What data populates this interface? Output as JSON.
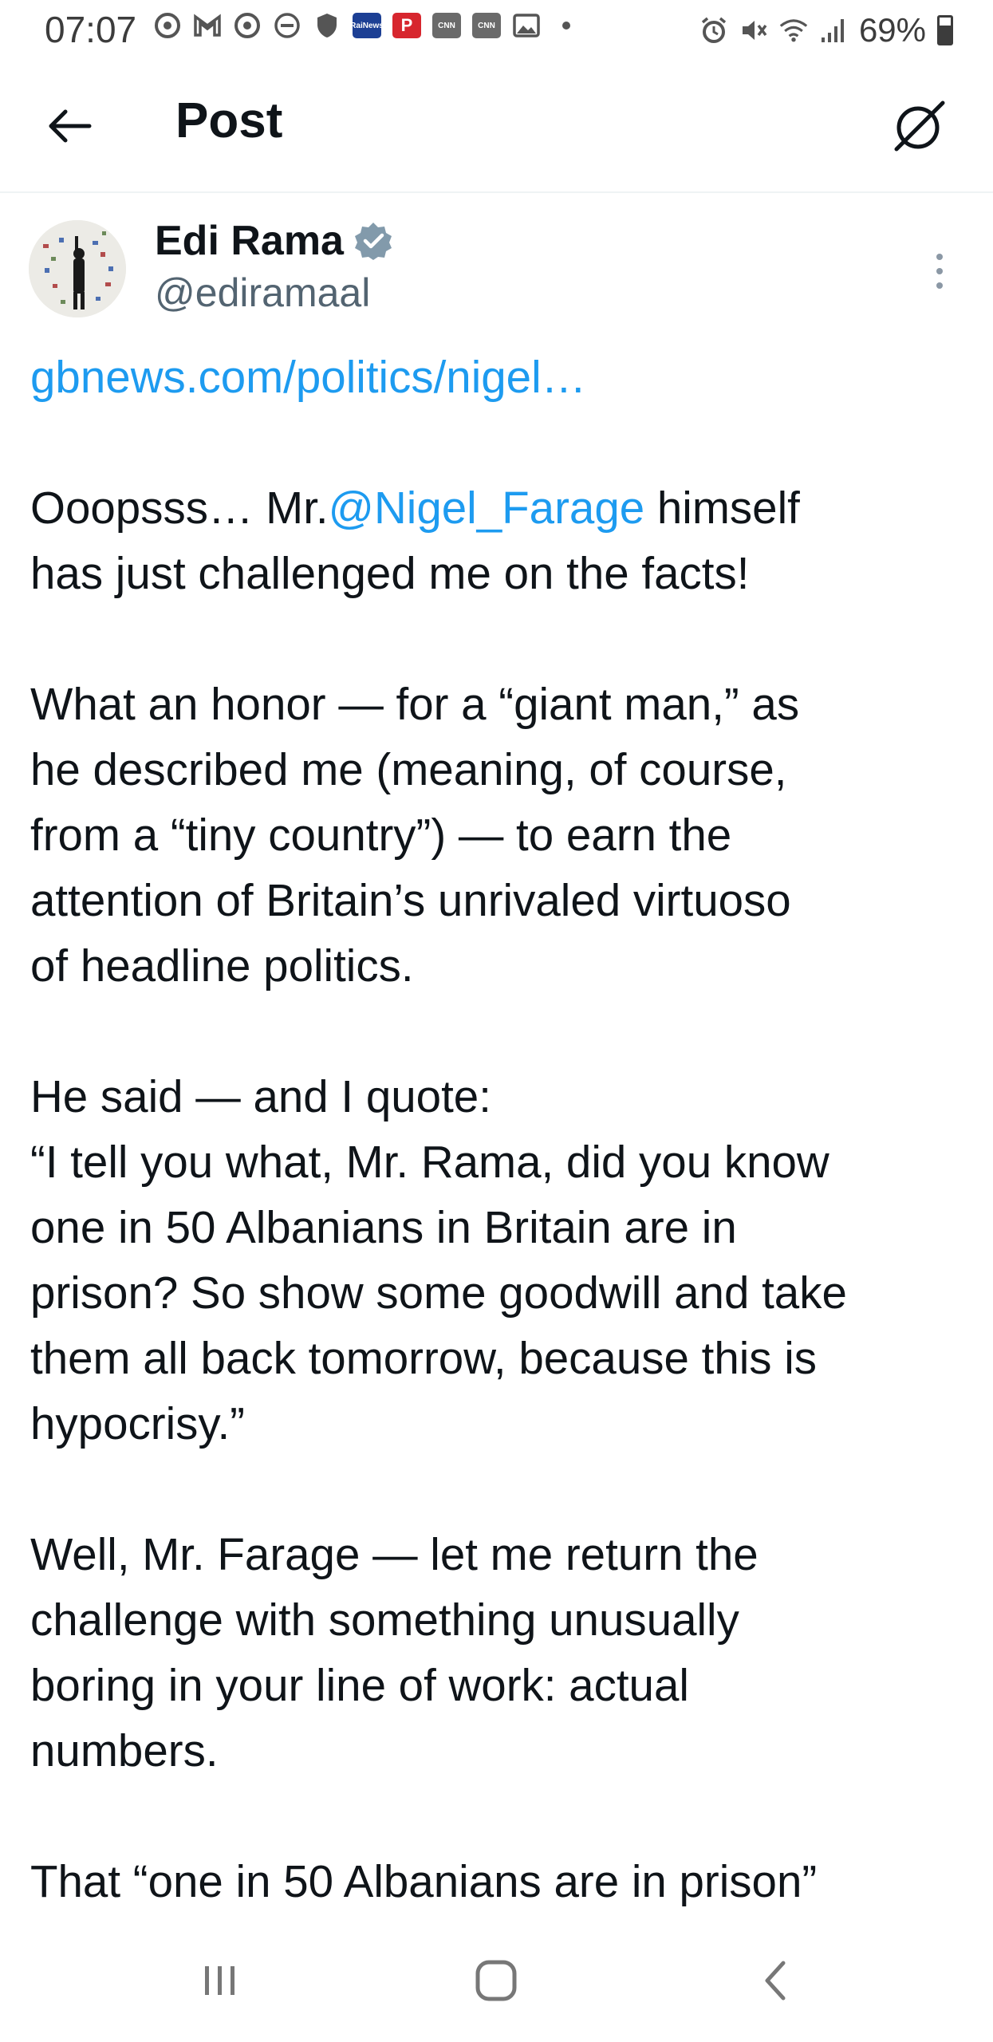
{
  "status_bar": {
    "time": "07:07",
    "battery": "69%",
    "battery_level": 0.69,
    "left_icons": [
      "chrome-icon",
      "gmail-icon",
      "chrome-icon",
      "dnd-icon",
      "shield-icon",
      "rai-news-icon",
      "p-app-icon",
      "cnn-icon",
      "cnn-icon",
      "gallery-icon",
      "dot-icon"
    ],
    "cnn_label": "CNN",
    "rai_label": "RaiNews",
    "p_label": "P",
    "right_icons": [
      "alarm-icon",
      "mute-icon",
      "wifi-icon",
      "signal-icon",
      "battery-icon"
    ]
  },
  "header": {
    "title": "Post"
  },
  "author": {
    "name": "Edi Rama",
    "handle": "@ediramaal",
    "verified_color": "#829aab"
  },
  "post": {
    "paragraphs": [
      {
        "lines": [
          [
            {
              "text": "gbnews.com/politics/nigel…",
              "link": true
            }
          ]
        ]
      },
      {
        "lines": [
          [
            {
              "text": "Ooopsss… Mr."
            },
            {
              "text": "@Nigel_Farage",
              "link": true
            },
            {
              "text": " himself"
            }
          ],
          [
            {
              "text": "has just challenged me on the facts!"
            }
          ]
        ]
      },
      {
        "lines": [
          [
            {
              "text": "What an honor — for a “giant man,” as"
            }
          ],
          [
            {
              "text": "he described me (meaning, of course,"
            }
          ],
          [
            {
              "text": "from a “tiny country”) — to earn the"
            }
          ],
          [
            {
              "text": "attention of Britain’s unrivaled virtuoso"
            }
          ],
          [
            {
              "text": "of headline politics."
            }
          ]
        ]
      },
      {
        "lines": [
          [
            {
              "text": "He said — and I quote:"
            }
          ],
          [
            {
              "text": "“I tell you what, Mr. Rama, did you know"
            }
          ],
          [
            {
              "text": "one in 50 Albanians in Britain are in"
            }
          ],
          [
            {
              "text": "prison? So show some goodwill and take"
            }
          ],
          [
            {
              "text": "them all back tomorrow, because this is"
            }
          ],
          [
            {
              "text": "hypocrisy.”"
            }
          ]
        ]
      },
      {
        "lines": [
          [
            {
              "text": "Well, Mr. Farage — let me return the"
            }
          ],
          [
            {
              "text": "challenge with something unusually"
            }
          ],
          [
            {
              "text": "boring in your line of work: actual"
            }
          ],
          [
            {
              "text": "numbers."
            }
          ]
        ]
      },
      {
        "lines": [
          [
            {
              "text": "That “one in 50 Albanians are in prison”"
            }
          ]
        ]
      }
    ]
  },
  "colors": {
    "link": "#1d9bf0",
    "text": "#0f1419",
    "secondary": "#536471"
  },
  "nav": {
    "icons": [
      "recent-apps-icon",
      "home-icon",
      "back-icon"
    ]
  }
}
